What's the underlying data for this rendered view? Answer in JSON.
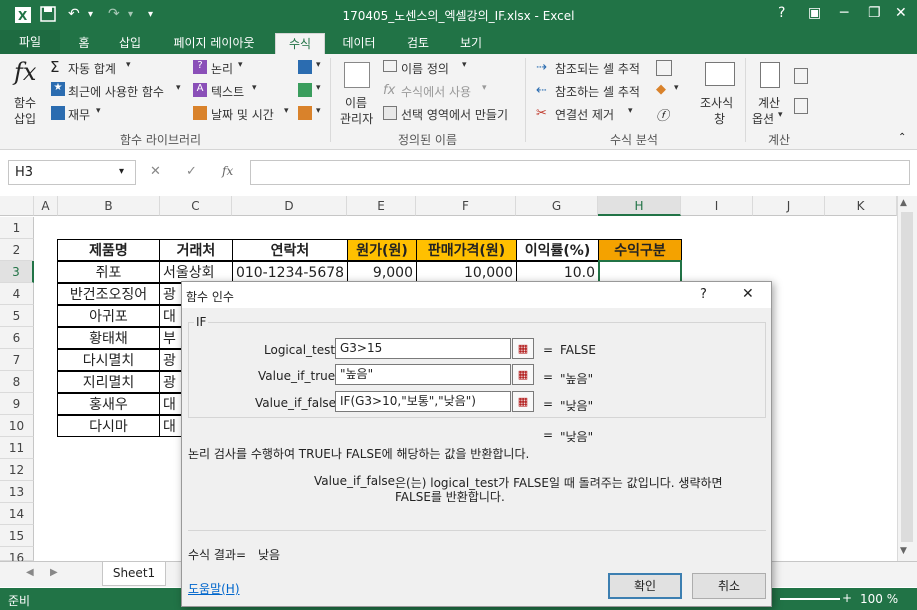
{
  "window": {
    "title": "170405_노센스의_엑셀강의_IF.xlsx - Excel",
    "help": "?",
    "minimize": "─",
    "restore": "❐",
    "close": "✕"
  },
  "tabs": [
    "파일",
    "홈",
    "삽입",
    "페이지 레이아웃",
    "수식",
    "데이터",
    "검토",
    "보기"
  ],
  "active_tab": "수식",
  "ribbon": {
    "insert_function": "함수\n삽입",
    "insert_function_l1": "함수",
    "insert_function_l2": "삽입",
    "autosum": "자동 합계",
    "recent": "최근에 사용한 함수",
    "financial": "재무",
    "logical": "논리",
    "text": "텍스트",
    "datetime": "날짜 및 시간",
    "lib_label": "함수 라이브러리",
    "name_mgr_l1": "이름",
    "name_mgr_l2": "관리자",
    "define_name": "이름 정의",
    "use_in_formula": "수식에서 사용",
    "create_from_sel": "선택 영역에서 만들기",
    "names_label": "정의된 이름",
    "trace_prec": "참조되는 셀 추적",
    "trace_dep": "참조하는 셀 추적",
    "remove_arrows": "연결선 제거",
    "audit_label": "수식 분석",
    "watch_l1": "조사식",
    "watch_l2": "창",
    "calc_opts_l1": "계산",
    "calc_opts_l2": "옵션",
    "calc_label": "계산"
  },
  "name_box": "H3",
  "formula_icons": {
    "cancel": "✕",
    "enter": "✓",
    "fx": "fx"
  },
  "columns": [
    "A",
    "B",
    "C",
    "D",
    "E",
    "F",
    "G",
    "H",
    "I",
    "J",
    "K"
  ],
  "selected_column": "H",
  "rows": [
    "1",
    "2",
    "3",
    "4",
    "5",
    "6",
    "7",
    "8",
    "9",
    "10",
    "11",
    "12",
    "13",
    "14",
    "15",
    "16"
  ],
  "selected_row": "3",
  "table": {
    "headers": [
      "제품명",
      "거래처",
      "연락처",
      "원가(원)",
      "판매가격(원)",
      "이익률(%)",
      "수익구분"
    ],
    "row3": [
      "쥐포",
      "서울상회",
      "010-1234-5678",
      "9,000",
      "10,000",
      "10.0"
    ],
    "products": [
      "반건조오징어",
      "아귀포",
      "황태채",
      "다시멸치",
      "지리멸치",
      "홍새우",
      "다시마"
    ],
    "vendors_partial": [
      "광",
      "대",
      "부",
      "광",
      "광",
      "대",
      "대"
    ]
  },
  "sheet_tab": "Sheet1",
  "status": {
    "ready": "준비",
    "zoom": "100 %"
  },
  "dialog": {
    "title": "함수 인수",
    "help": "?",
    "close": "✕",
    "func_name": "IF",
    "args": [
      {
        "label": "Logical_test",
        "value": "G3>15",
        "result": "FALSE"
      },
      {
        "label": "Value_if_true",
        "value": "\"높음\"",
        "result": "\"높음\""
      },
      {
        "label": "Value_if_false",
        "value": "IF(G3>10,\"보통\",\"낮음\")",
        "result": "\"낮음\""
      }
    ],
    "eq": "=",
    "overall_result": "\"낮음\"",
    "description": "논리 검사를 수행하여 TRUE나 FALSE에 해당하는 값을 반환합니다.",
    "arg_name": "Value_if_false",
    "arg_help_line1": "은(는) logical_test가 FALSE일 때 돌려주는 값입니다. 생략하면",
    "arg_help_line2": "FALSE를 반환합니다.",
    "formula_result_label": "수식 결과=",
    "formula_result_value": "낮음",
    "help_link": "도움말(H)",
    "ok": "확인",
    "cancel": "취소"
  }
}
